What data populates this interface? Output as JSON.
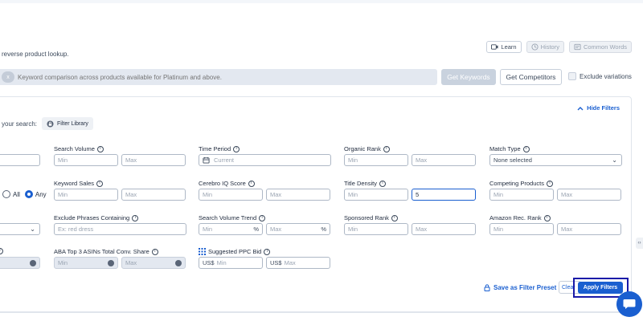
{
  "header": {
    "subtitle": "reverse product lookup.",
    "learn_label": "Learn",
    "history_label": "History",
    "common_words_label": "Common Words"
  },
  "search": {
    "pill_label": "x",
    "placeholder": "Keyword comparison across products available for Platinum and above.",
    "get_keywords_label": "Get Keywords",
    "get_competitors_label": "Get Competitors",
    "exclude_variations_label": "Exclude variations"
  },
  "panel": {
    "hide_filters_label": "Hide Filters",
    "your_search_label": "your search:",
    "filter_library_label": "Filter Library"
  },
  "filters": {
    "search_volume": {
      "label": "Search Volume",
      "min": "Min",
      "max": "Max"
    },
    "time_period": {
      "label": "Time Period",
      "placeholder": "Current"
    },
    "organic_rank": {
      "label": "Organic Rank",
      "min": "Min",
      "max": "Max"
    },
    "match_type": {
      "label": "Match Type",
      "value": "None selected"
    },
    "keyword_sales": {
      "label": "Keyword Sales",
      "min": "Min",
      "max": "Max"
    },
    "cerebro_iq": {
      "label": "Cerebro IQ Score",
      "min": "Min",
      "max": "Max"
    },
    "title_density": {
      "label": "Title Density",
      "min": "Min",
      "max_value": "5"
    },
    "competing_products": {
      "label": "Competing Products",
      "min": "Min",
      "max": "Max"
    },
    "radio": {
      "all_label": "All",
      "any_label": "Any",
      "selected": "Any"
    },
    "exclude_phrases": {
      "label": "Exclude Phrases Containing",
      "placeholder": "Ex: red dress"
    },
    "sv_trend": {
      "label": "Search Volume Trend",
      "min": "Min",
      "max": "Max",
      "suffix": "%"
    },
    "sponsored_rank": {
      "label": "Sponsored Rank",
      "min": "Min",
      "max": "Max"
    },
    "amazon_rec_rank": {
      "label": "Amazon Rec. Rank",
      "min": "Min",
      "max": "Max"
    },
    "aba_top3": {
      "label": "ABA Top 3 ASINs Total Conv. Share",
      "min": "Min",
      "max": "Max"
    },
    "ppc_bid": {
      "label": "Suggested PPC Bid",
      "currency": "US$",
      "min": "Min",
      "max": "Max"
    }
  },
  "footer": {
    "save_preset_label": "Save as Filter Preset",
    "clear_label": "Clear",
    "apply_label": "Apply Filters"
  },
  "colors": {
    "accent": "#1a5fd0",
    "highlight_border": "#1a1aa8"
  }
}
